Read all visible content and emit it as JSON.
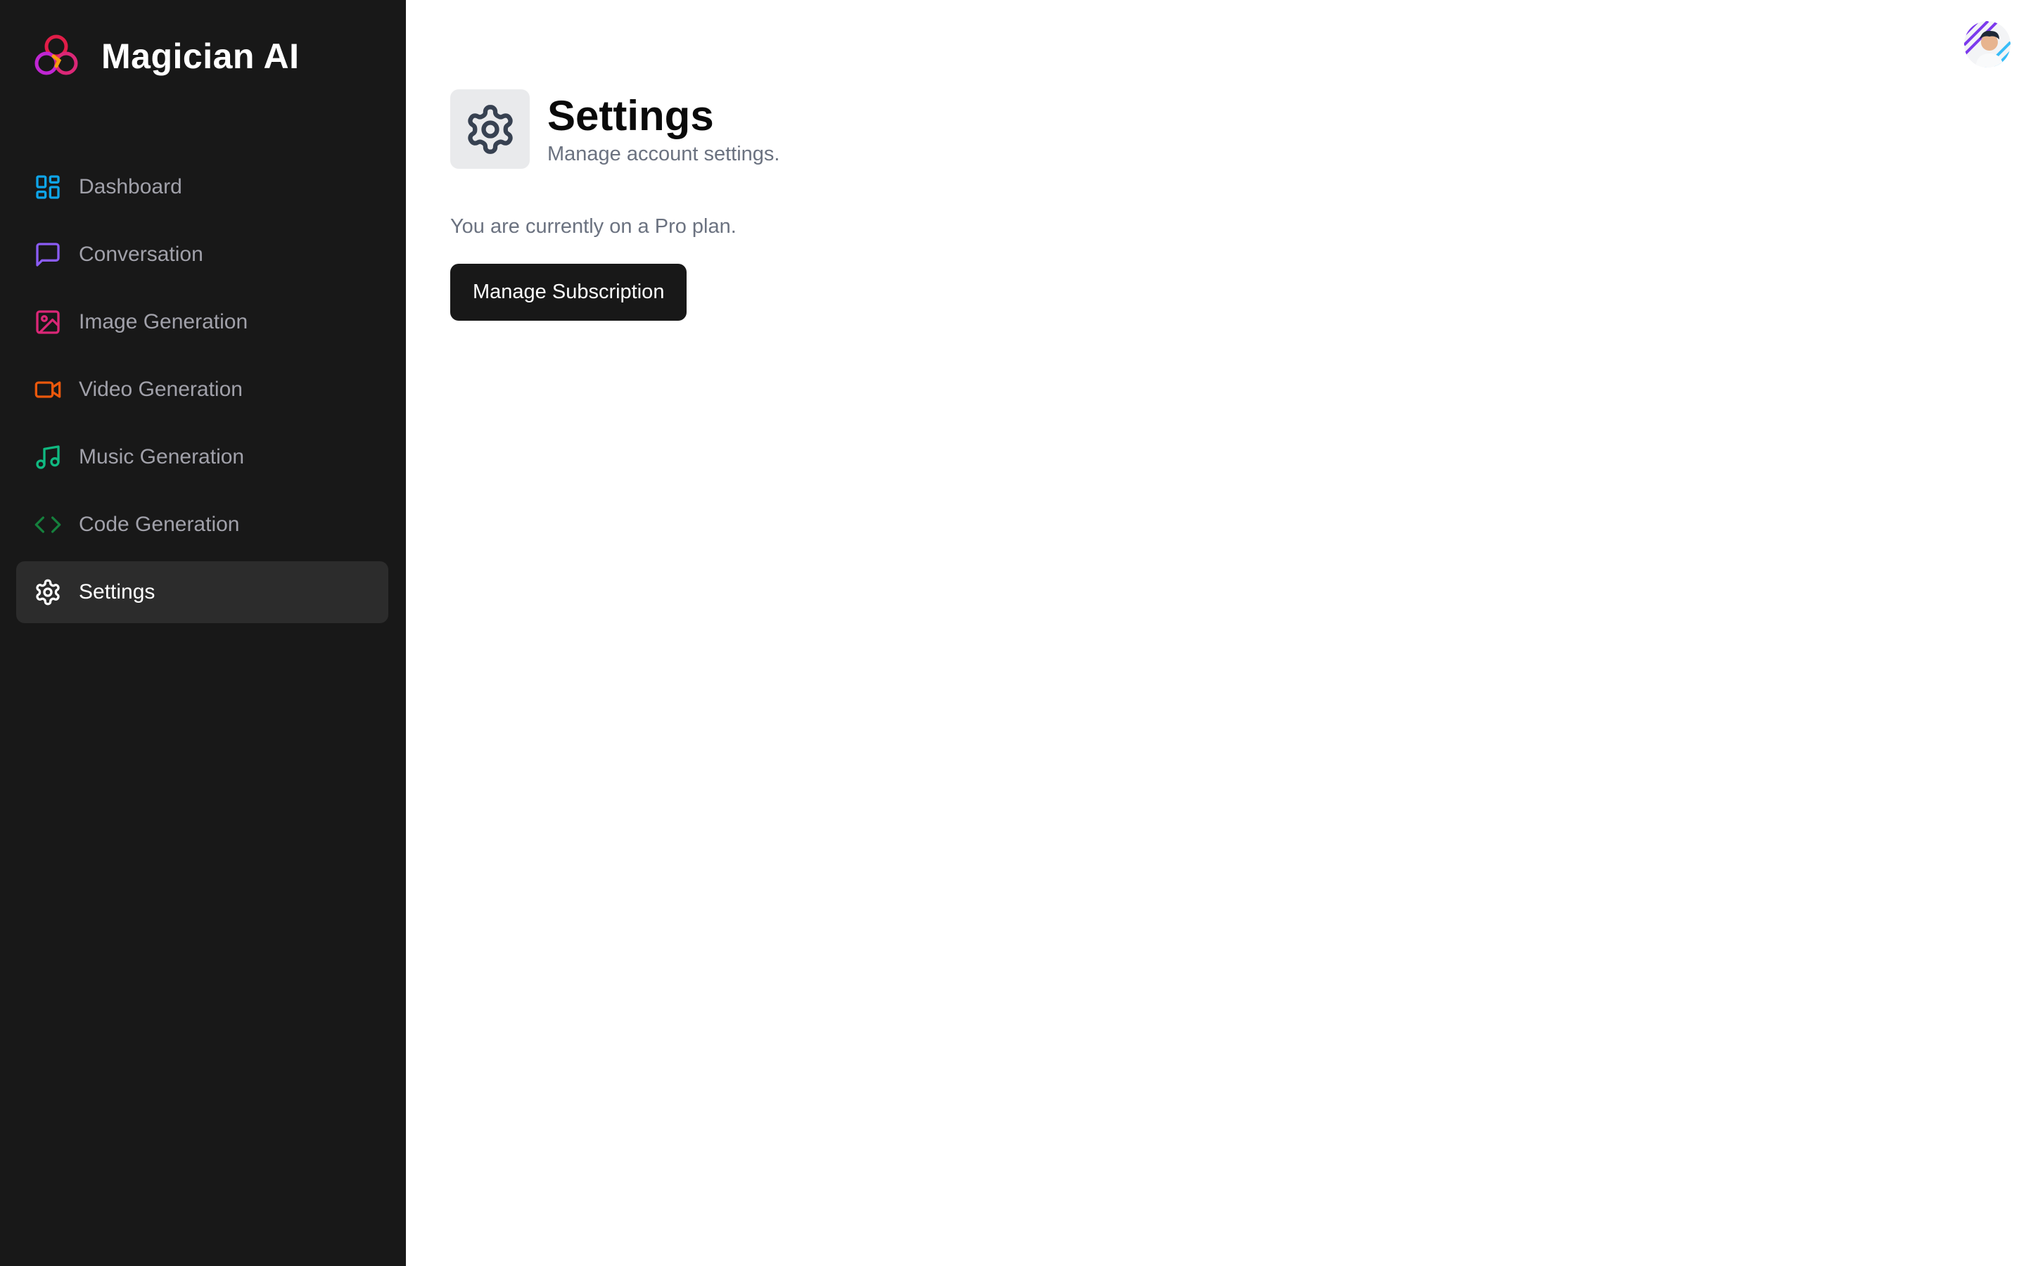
{
  "brand": {
    "name": "Magician AI"
  },
  "sidebar": {
    "items": [
      {
        "label": "Dashboard",
        "icon": "dashboard-icon",
        "color": "#0ea5e9",
        "active": false
      },
      {
        "label": "Conversation",
        "icon": "message-square-icon",
        "color": "#8b5cf6",
        "active": false
      },
      {
        "label": "Image Generation",
        "icon": "image-icon",
        "color": "#db2777",
        "active": false
      },
      {
        "label": "Video Generation",
        "icon": "video-icon",
        "color": "#ea580c",
        "active": false
      },
      {
        "label": "Music Generation",
        "icon": "music-icon",
        "color": "#10b981",
        "active": false
      },
      {
        "label": "Code Generation",
        "icon": "code-icon",
        "color": "#15803d",
        "active": true
      },
      {
        "label": "Settings",
        "icon": "settings-icon",
        "color": "#ffffff",
        "active": true
      }
    ]
  },
  "header": {
    "title": "Settings",
    "subtitle": "Manage account settings.",
    "icon": "settings-icon"
  },
  "main": {
    "plan_text": "You are currently on a Pro plan.",
    "manage_button_label": "Manage Subscription"
  },
  "user": {
    "avatar": "user-avatar"
  }
}
